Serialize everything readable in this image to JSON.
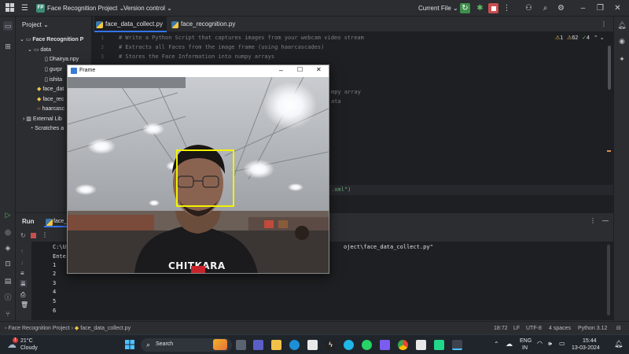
{
  "titlebar": {
    "project_badge": "FP",
    "project_name": "Face Recognition Project",
    "vcs": "Version control",
    "run_config": "Current File"
  },
  "project_panel": {
    "title": "Project",
    "items": [
      {
        "label": "Face Recognition P"
      },
      {
        "label": "data"
      },
      {
        "label": "Dhairya.npy"
      },
      {
        "label": "gurpr"
      },
      {
        "label": "ishita"
      },
      {
        "label": "face_dat"
      },
      {
        "label": "face_rec"
      },
      {
        "label": "haarcasc"
      },
      {
        "label": "External Lib"
      },
      {
        "label": "Scratches a"
      }
    ]
  },
  "tabs": [
    {
      "label": "face_data_collect.py"
    },
    {
      "label": "face_recognition.py"
    }
  ],
  "inspections": {
    "warnings": "1",
    "weak": "62",
    "ok": "4"
  },
  "editor": {
    "lines": [
      {
        "n": "1",
        "text": "# Write a Python Script that captures images from your webcam video stream"
      },
      {
        "n": "2",
        "text": "# Extracts all Faces from the image frame (using haarcascades)"
      },
      {
        "n": "3",
        "text": "# Stores the Face Information into numpy arrays"
      }
    ],
    "frag1": "mpy array",
    "frag2": "ata",
    "frag3": ".xml\")"
  },
  "run": {
    "title": "Run",
    "tab_label": "face_d",
    "console": [
      "C:\\Users\\",
      "Enter the",
      "1",
      "2",
      "3",
      "4",
      "5",
      "6"
    ],
    "console_tail": "oject\\face_data_collect.py\""
  },
  "frame_window": {
    "title": "Frame",
    "shirt_text": "CHITKARA"
  },
  "statusbar": {
    "breadcrumb_project": "Face Recognition Project",
    "breadcrumb_file": "face_data_collect.py",
    "position": "18:72",
    "line_sep": "LF",
    "encoding": "UTF-8",
    "indent": "4 spaces",
    "interpreter": "Python 3.12"
  },
  "taskbar": {
    "temp": "21°C",
    "weather": "Cloudy",
    "weather_badge": "1",
    "search_placeholder": "Search",
    "lang": "ENG",
    "region": "IN",
    "time": "15:44",
    "date": "13-03-2024"
  },
  "colors": {
    "accent": "#3574f0",
    "face_box": "#f2f200",
    "ide_bg": "#1e1f22",
    "panel_bg": "#2b2d30"
  }
}
